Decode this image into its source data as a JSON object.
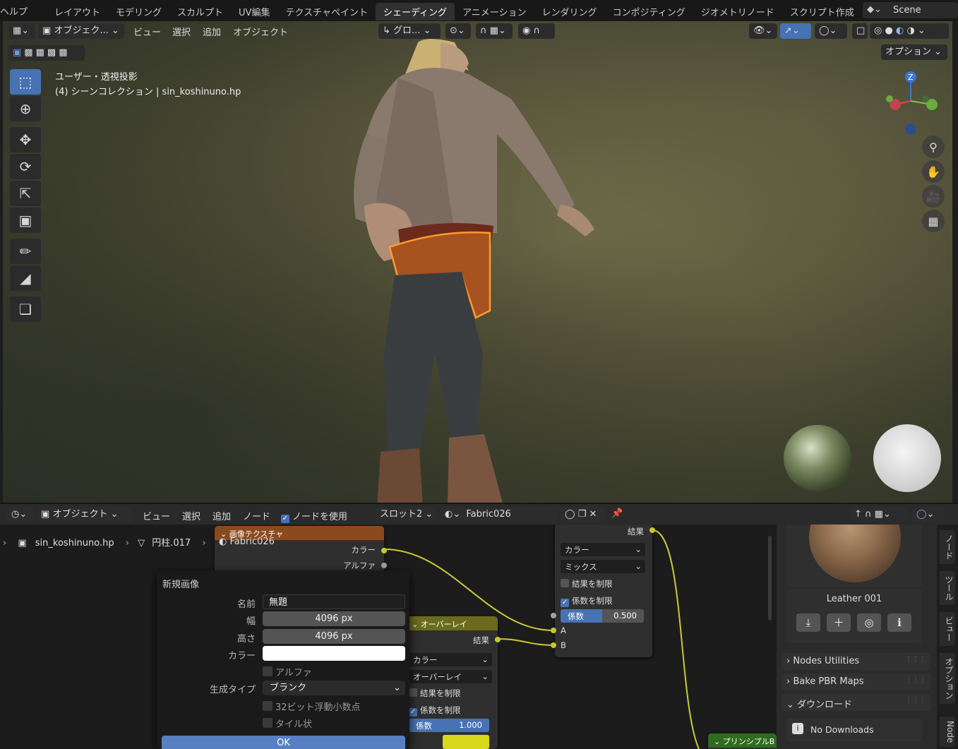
{
  "topbar": {
    "help": "ヘルプ",
    "tabs": [
      "レイアウト",
      "モデリング",
      "スカルプト",
      "UV編集",
      "テクスチャペイント",
      "シェーディング",
      "アニメーション",
      "レンダリング",
      "コンポジティング",
      "ジオメトリノード",
      "スクリプト作成"
    ],
    "active_tab": "シェーディング",
    "scene": "Scene"
  },
  "viewport": {
    "mode": "オブジェク...",
    "menu": [
      "ビュー",
      "選択",
      "追加",
      "オブジェクト"
    ],
    "transform_orientation": "グロ...",
    "options_button": "オプション",
    "overlay_line1": "ユーザー・透視投影",
    "overlay_line2": "(4) シーンコレクション | sin_koshinuno.hp",
    "gizmo_z": "Z",
    "tools": [
      "select-box-icon",
      "cursor-icon",
      "move-icon",
      "rotate-icon",
      "scale-icon",
      "transform-icon",
      "annotate-icon",
      "measure-icon",
      "add-cube-icon"
    ]
  },
  "node_header": {
    "mode": "オブジェクト",
    "menu": [
      "ビュー",
      "選択",
      "追加",
      "ノード"
    ],
    "use_nodes_label": "ノードを使用",
    "slot": "スロット2",
    "material": "Fabric026"
  },
  "breadcrumb": {
    "object": "sin_koshinuno.hp",
    "mesh": "円柱.017"
  },
  "nodes": {
    "image_texture": {
      "title": "画像テクスチャ",
      "image": "Fabric026",
      "out_color": "カラー",
      "out_alpha": "アルファ"
    },
    "overlay": {
      "title": "オーバーレイ",
      "out_result": "結果",
      "type_drop": "カラー",
      "blend_drop": "オーバーレイ",
      "clamp_result": "結果を制限",
      "clamp_factor": "係数を制限",
      "factor_label": "係数",
      "factor_value": "1.000",
      "factor": 1.0
    },
    "mix": {
      "out_result": "結果",
      "type_drop": "カラー",
      "blend_drop": "ミックス",
      "clamp_result": "結果を制限",
      "clamp_factor": "係数を制限",
      "factor_label": "係数",
      "factor_value": "0.500",
      "factor": 0.5,
      "in_a": "A",
      "in_b": "B"
    },
    "principled": "プリンシプルB"
  },
  "popup": {
    "title": "新規画像",
    "name_label": "名前",
    "name_value": "無題",
    "width_label": "幅",
    "width_value": "4096 px",
    "height_label": "高さ",
    "height_value": "4096 px",
    "color_label": "カラー",
    "color_value": "#ffffff",
    "alpha_label": "アルファ",
    "gen_type_label": "生成タイプ",
    "gen_type_value": "ブランク",
    "float_label": "32ビット浮動小数点",
    "tiled_label": "タイル状",
    "ok_label": "OK"
  },
  "sidepanel": {
    "material_name": "Leather 001",
    "sections": [
      "Nodes Utilities",
      "Bake PBR Maps",
      "ダウンロード"
    ],
    "no_downloads": "No Downloads",
    "vertical_tabs": [
      "ノード",
      "ツール",
      "ビュー",
      "オプション",
      "Node"
    ]
  },
  "colors": {
    "accent": "#4772b3",
    "image_node_header": "#8a4a1e",
    "overlay_node_header": "#6b6b1e",
    "principled_header": "#2f6b1f",
    "socket_yellow": "#c7c729",
    "link_yellow": "#c9c93a"
  }
}
